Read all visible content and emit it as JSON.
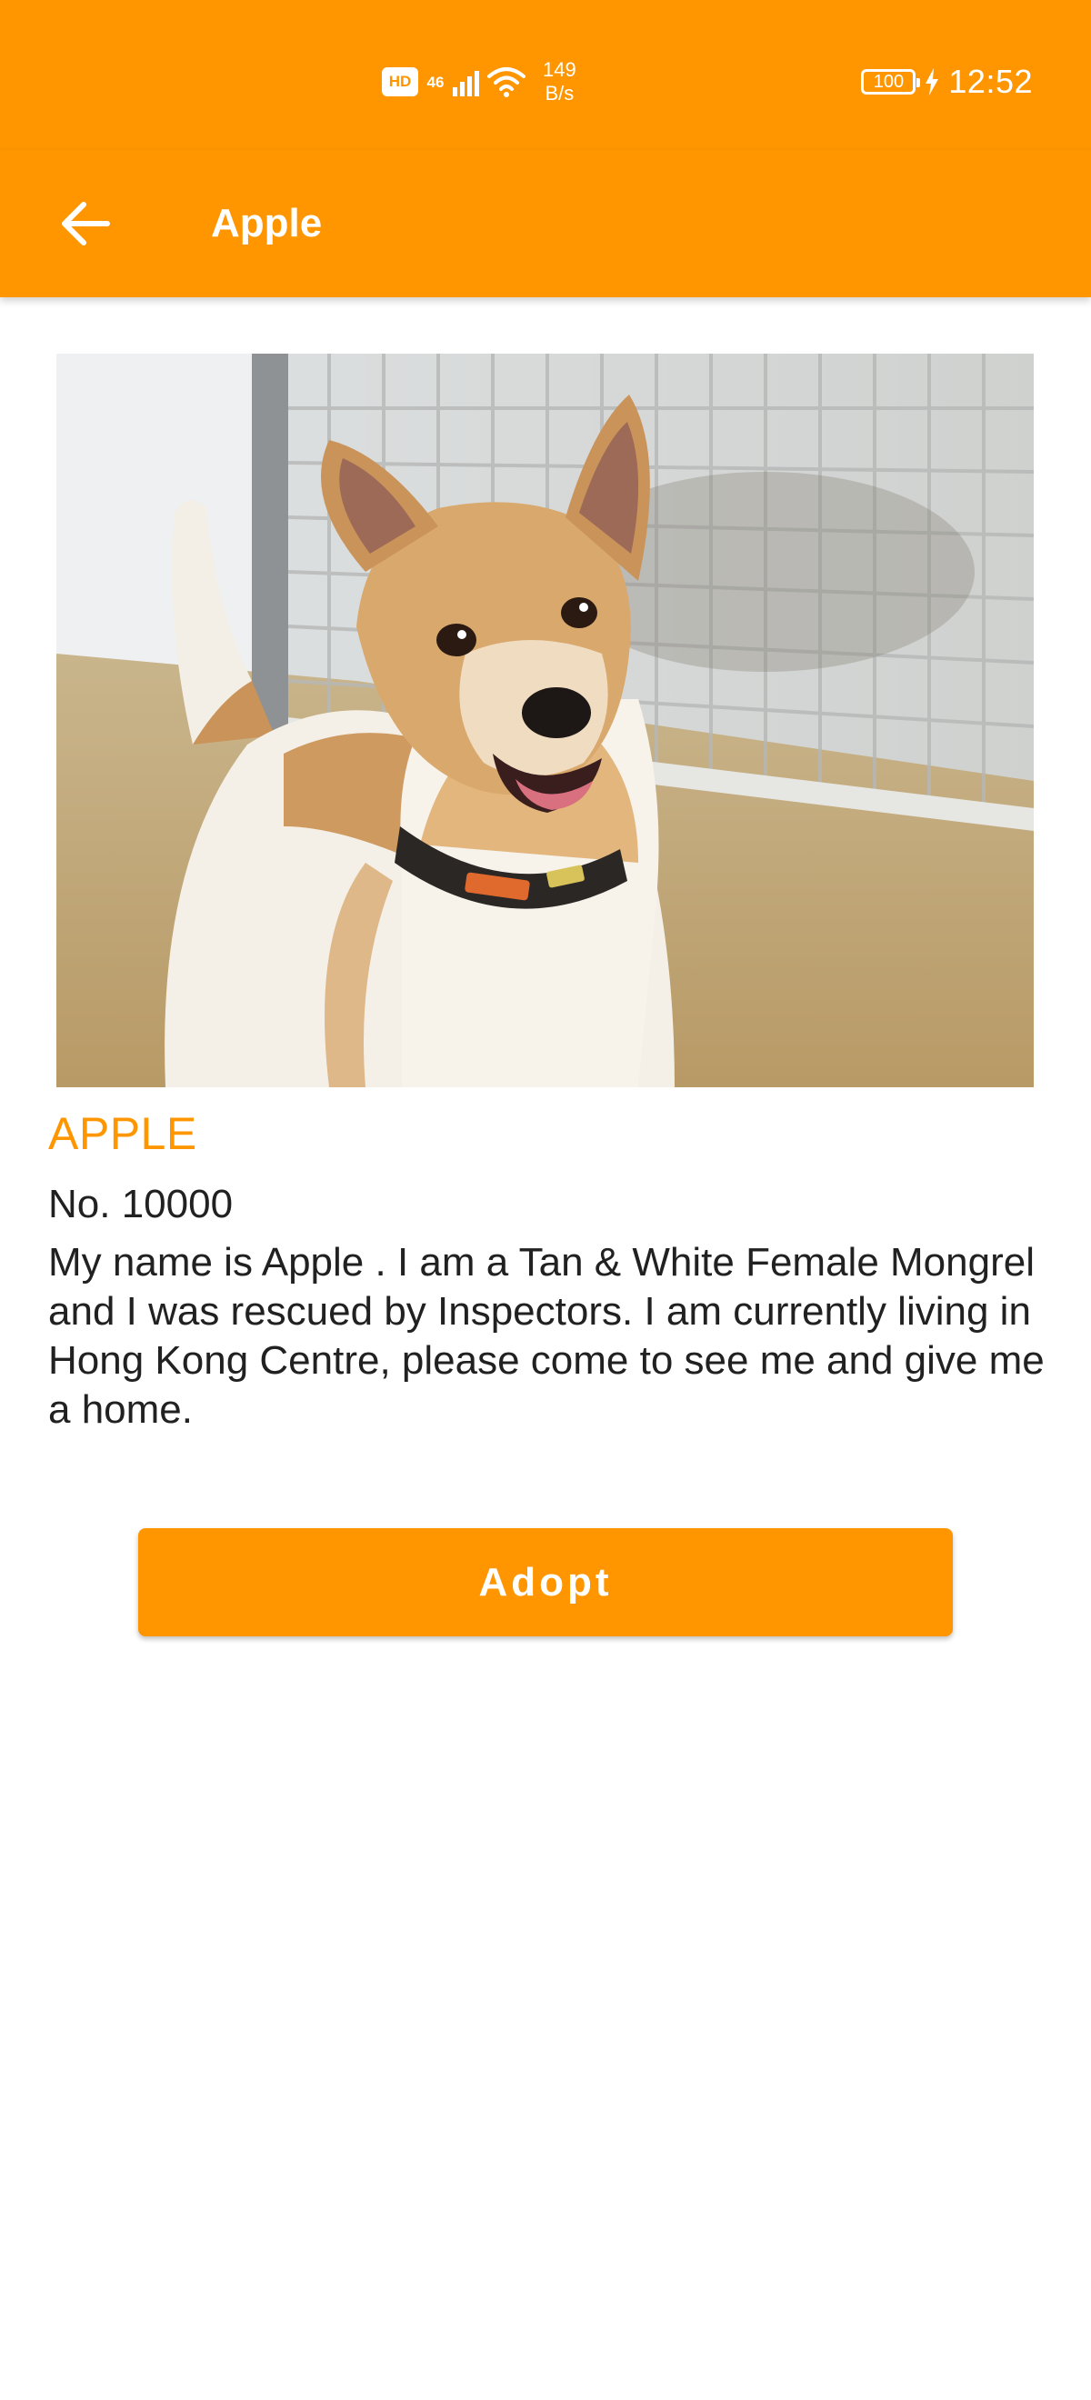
{
  "status_bar": {
    "hd_label": "HD",
    "network_type": "46",
    "network_speed_value": "149",
    "network_speed_unit": "B/s",
    "battery_level": "100",
    "time": "12:52",
    "icons": [
      "hd-icon",
      "signal-icon",
      "wifi-icon",
      "battery-icon",
      "charging-icon"
    ]
  },
  "app_bar": {
    "title": "Apple",
    "back_icon": "arrow-left-icon"
  },
  "pet": {
    "name": "APPLE",
    "number": "No. 10000",
    "description": "My name is Apple . I am a Tan & White Female Mongrel and I was rescued by Inspectors. I am currently living in Hong Kong Centre, please come to see me and give me a home."
  },
  "actions": {
    "adopt_label": "Adopt"
  },
  "colors": {
    "primary": "#FF9600",
    "text": "#212121",
    "background": "#FFFFFF"
  }
}
